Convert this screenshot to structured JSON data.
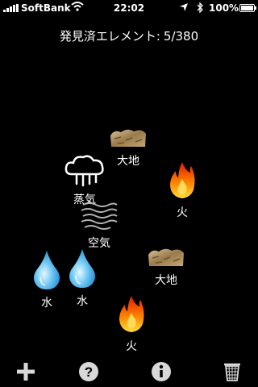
{
  "status": {
    "carrier": "SoftBank",
    "time": "22:02",
    "battery_pct": "100%",
    "battery_level": 1.0,
    "icons": [
      "signal-icon",
      "wifi-icon",
      "location-arrow-icon",
      "bluetooth-icon",
      "battery-icon"
    ]
  },
  "header": {
    "label": "発見済エレメント:",
    "count": "5/380"
  },
  "elements": {
    "earth_1": {
      "label": "大地",
      "icon": "earth-icon"
    },
    "steam": {
      "label": "蒸気",
      "icon": "steam-cloud-icon"
    },
    "fire_1": {
      "label": "火",
      "icon": "fire-icon"
    },
    "air": {
      "label": "空気",
      "icon": "air-icon"
    },
    "earth_2": {
      "label": "大地",
      "icon": "earth-icon"
    },
    "water_1": {
      "label": "水",
      "icon": "water-drop-icon"
    },
    "water_2": {
      "label": "水",
      "icon": "water-drop-icon"
    },
    "fire_2": {
      "label": "火",
      "icon": "fire-icon"
    }
  },
  "toolbar": {
    "icons": [
      "plus-icon",
      "help-icon",
      "info-icon",
      "trash-icon"
    ]
  },
  "colors": {
    "background": "#000000",
    "text": "#ffffff",
    "fire_outer": "#ff5a00",
    "fire_inner": "#ffd24a",
    "water": "#4fb6f0",
    "earth": "#b89a6a"
  }
}
